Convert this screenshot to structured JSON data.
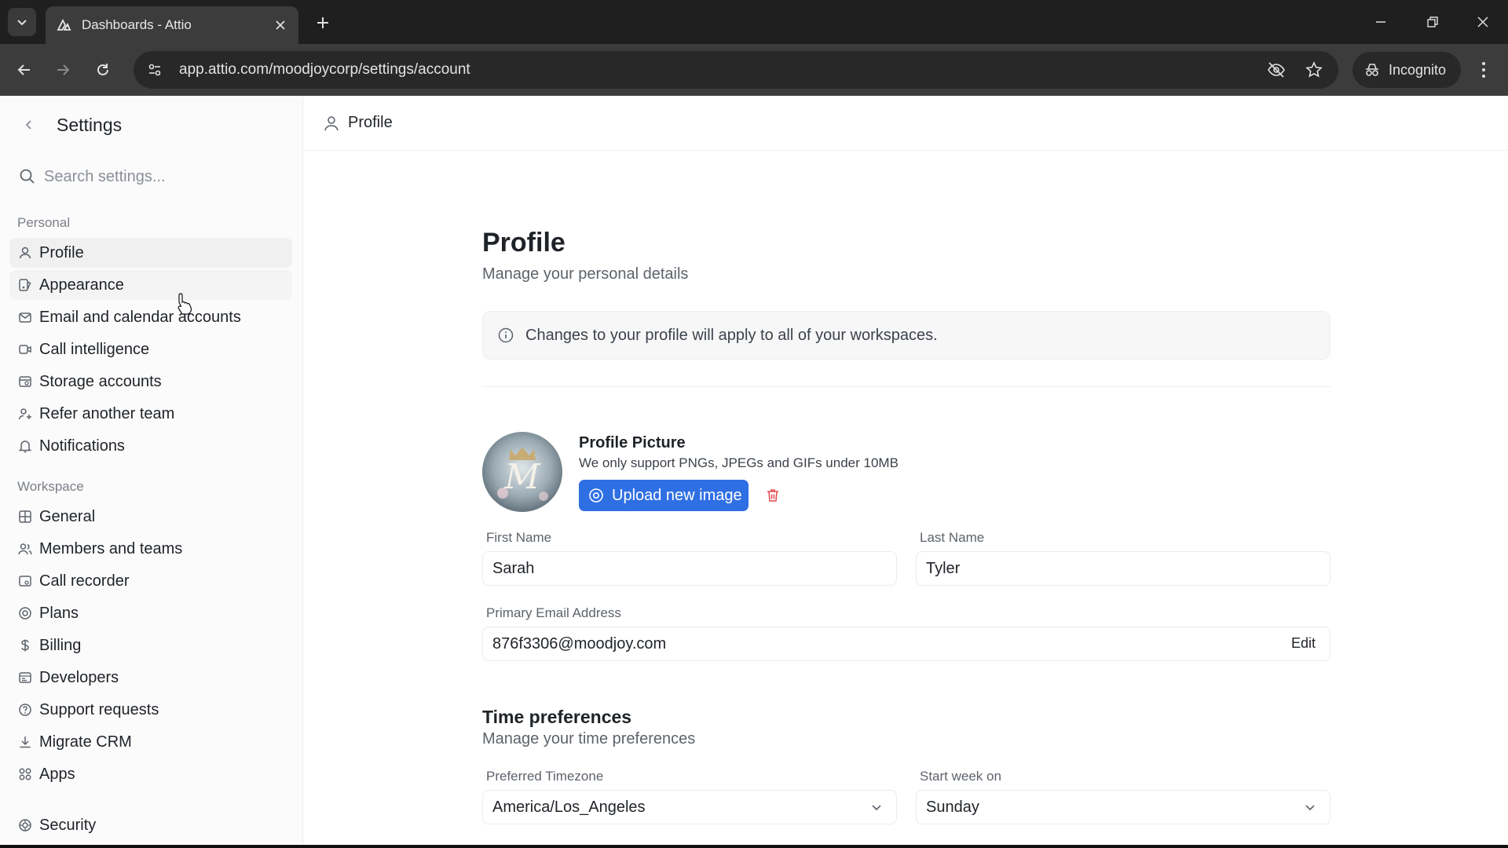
{
  "browser": {
    "tab_title": "Dashboards - Attio",
    "url": "app.attio.com/moodjoycorp/settings/account",
    "incognito_label": "Incognito"
  },
  "sidebar": {
    "title": "Settings",
    "search_placeholder": "Search settings...",
    "personal_heading": "Personal",
    "personal_items": [
      {
        "label": "Profile",
        "icon": "user-icon"
      },
      {
        "label": "Appearance",
        "icon": "appearance-icon"
      },
      {
        "label": "Email and calendar accounts",
        "icon": "mail-icon"
      },
      {
        "label": "Call intelligence",
        "icon": "video-icon"
      },
      {
        "label": "Storage accounts",
        "icon": "storage-icon"
      },
      {
        "label": "Refer another team",
        "icon": "refer-icon"
      },
      {
        "label": "Notifications",
        "icon": "bell-icon"
      }
    ],
    "workspace_heading": "Workspace",
    "workspace_items": [
      {
        "label": "General",
        "icon": "grid-icon"
      },
      {
        "label": "Members and teams",
        "icon": "users-icon"
      },
      {
        "label": "Call recorder",
        "icon": "recorder-icon"
      },
      {
        "label": "Plans",
        "icon": "plans-icon"
      },
      {
        "label": "Billing",
        "icon": "dollar-icon"
      },
      {
        "label": "Developers",
        "icon": "code-icon"
      },
      {
        "label": "Support requests",
        "icon": "help-icon"
      },
      {
        "label": "Migrate CRM",
        "icon": "download-icon"
      },
      {
        "label": "Apps",
        "icon": "apps-icon"
      },
      {
        "label": "Security",
        "icon": "shield-icon"
      }
    ]
  },
  "header": {
    "title": "Profile"
  },
  "profile": {
    "title": "Profile",
    "subtitle": "Manage your personal details",
    "notice": "Changes to your profile will apply to all of your workspaces.",
    "picture_title": "Profile Picture",
    "picture_hint": "We only support PNGs, JPEGs and GIFs under 10MB",
    "upload_label": "Upload new image",
    "first_name_label": "First Name",
    "first_name": "Sarah",
    "last_name_label": "Last Name",
    "last_name": "Tyler",
    "email_label": "Primary Email Address",
    "email": "876f3306@moodjoy.com",
    "edit_label": "Edit"
  },
  "time_preferences": {
    "title": "Time preferences",
    "subtitle": "Manage your time preferences",
    "timezone_label": "Preferred Timezone",
    "timezone": "America/Los_Angeles",
    "week_start_label": "Start week on",
    "week_start": "Sunday"
  },
  "colors": {
    "accent": "#2f6fe4",
    "delete": "#e5484d"
  }
}
